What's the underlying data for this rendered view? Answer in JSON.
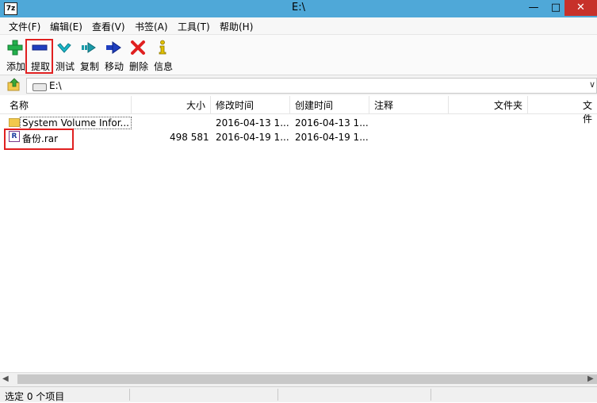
{
  "window": {
    "title": "E:\\",
    "app_icon_text": "7z",
    "minimize": "—",
    "maximize": "□",
    "close": "✕"
  },
  "menu": [
    "文件(F)",
    "编辑(E)",
    "查看(V)",
    "书签(A)",
    "工具(T)",
    "帮助(H)"
  ],
  "toolbar": [
    {
      "label": "添加",
      "icon": "add-icon",
      "color": "#22b14c"
    },
    {
      "label": "提取",
      "icon": "extract-icon",
      "color": "#1f3fbf"
    },
    {
      "label": "测试",
      "icon": "test-icon",
      "color": "#19b6c9"
    },
    {
      "label": "复制",
      "icon": "copy-icon",
      "color": "#1a9aa8"
    },
    {
      "label": "移动",
      "icon": "move-icon",
      "color": "#1f3fbf"
    },
    {
      "label": "删除",
      "icon": "delete-icon",
      "color": "#e02020"
    },
    {
      "label": "信息",
      "icon": "info-icon",
      "color": "#e0c000"
    }
  ],
  "address": {
    "path": "E:\\",
    "dropdown": "∨"
  },
  "columns": [
    "名称",
    "大小",
    "修改时间",
    "创建时间",
    "注释",
    "文件夹",
    "文件"
  ],
  "files": [
    {
      "name": "System Volume Infor...",
      "size": "",
      "modified": "2016-04-13 1...",
      "created": "2016-04-13 1...",
      "type": "folder"
    },
    {
      "name": "备份.rar",
      "size": "498 581",
      "modified": "2016-04-19 1...",
      "created": "2016-04-19 1...",
      "type": "rar"
    }
  ],
  "status": {
    "selected": "选定 0 个项目"
  },
  "colors": {
    "titlebar": "#4fa8d8",
    "highlight_box": "#e02020",
    "close_button": "#c7312a"
  }
}
